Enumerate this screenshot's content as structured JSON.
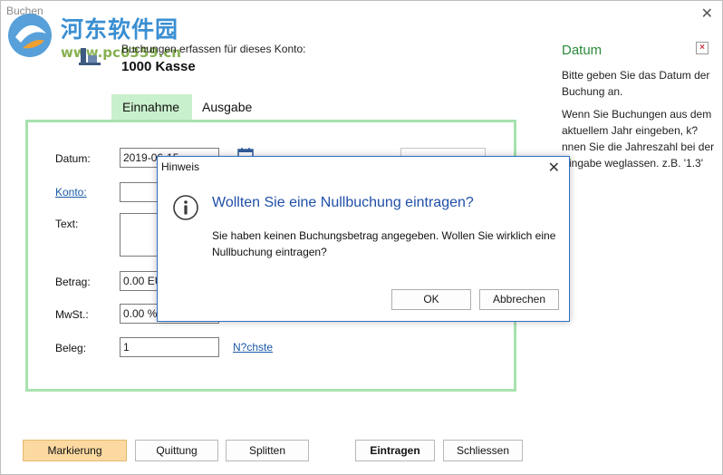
{
  "window": {
    "title": "Buchen"
  },
  "watermark": {
    "chinese": "河东软件园",
    "url": "www.pc0359.cn"
  },
  "account": {
    "subtitle": "Buchungen erfassen für dieses Konto:",
    "name": "1000 Kasse"
  },
  "tabs": [
    {
      "label": "Einnahme",
      "active": true
    },
    {
      "label": "Ausgabe",
      "active": false
    }
  ],
  "form": {
    "datum_label": "Datum:",
    "datum_value": "2019-06-15",
    "konto_label": "Konto:",
    "konto_value": "",
    "text_label": "Text:",
    "text_value": "",
    "betrag_label": "Betrag:",
    "betrag_value": "0.00 EUR",
    "mwst_label": "MwSt.:",
    "mwst_value": "0.00 %",
    "beleg_label": "Beleg:",
    "beleg_value": "1",
    "naechste_label": "N?chste"
  },
  "help": {
    "title": "Datum",
    "p1": "Bitte geben Sie das Datum der Buchung an.",
    "p2": "Wenn Sie Buchungen aus dem aktuellem Jahr eingeben, k?nnen Sie die Jahreszahl bei der Eingabe weglassen. z.B. '1.3'"
  },
  "buttons": {
    "markierung": "Markierung",
    "quittung": "Quittung",
    "splitten": "Splitten",
    "eintragen": "Eintragen",
    "schliessen": "Schliessen"
  },
  "dialog": {
    "title": "Hinweis",
    "heading": "Wollten Sie eine Nullbuchung eintragen?",
    "message": "Sie haben keinen Buchungsbetrag angegeben. Wollen Sie wirklich eine Nullbuchung eintragen?",
    "ok": "OK",
    "cancel": "Abbrechen"
  },
  "colors": {
    "tab_active": "#c9f0cc",
    "form_border": "#a8e2ae",
    "help_title": "#2a8a3a",
    "dialog_heading": "#1f4fa8",
    "markierung_bg": "#fbd9a1"
  }
}
